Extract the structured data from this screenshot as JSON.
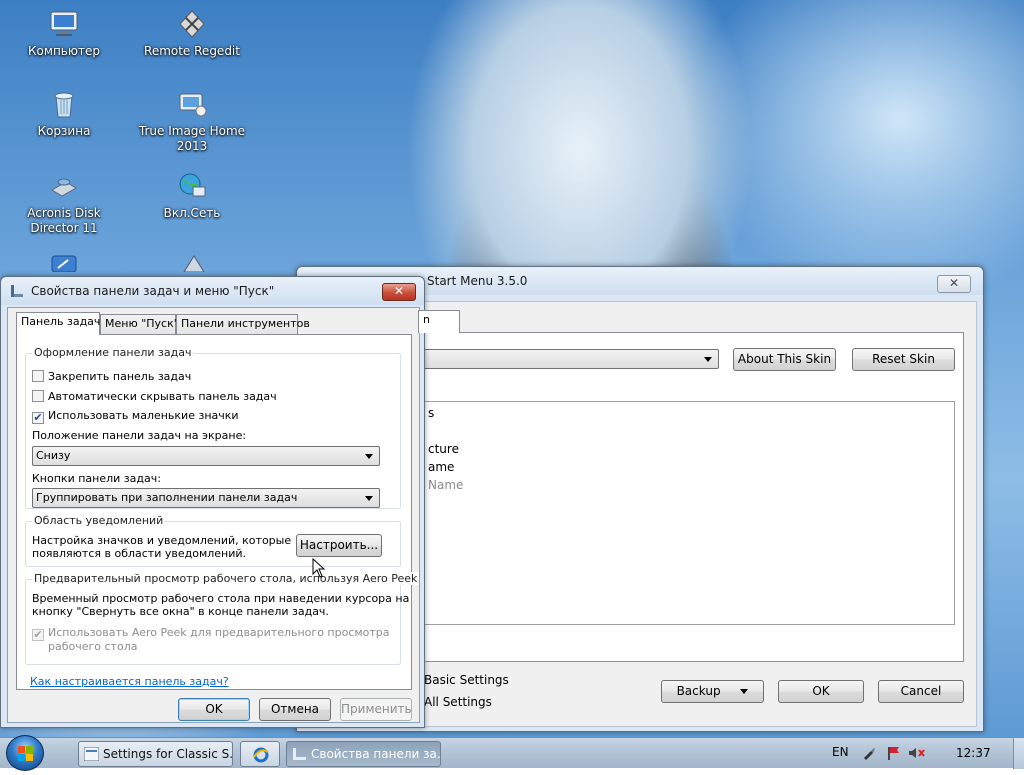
{
  "desktop": {
    "icons": [
      {
        "label": "Компьютер"
      },
      {
        "label": "Remote Regedit"
      },
      {
        "label": "Корзина"
      },
      {
        "label": "True Image Home 2013"
      },
      {
        "label": "Acronis Disk Director 11"
      },
      {
        "label": "Вкл.Сеть"
      }
    ]
  },
  "classic_window": {
    "title": "Start Menu 3.5.0",
    "tab_fragment": "n",
    "about_skin": "About This Skin",
    "reset_skin": "Reset Skin",
    "list_items": [
      "s",
      "cture",
      "ame",
      "Name"
    ],
    "radio_basic": "Basic Settings",
    "radio_all": "All Settings",
    "backup": "Backup",
    "ok": "OK",
    "cancel": "Cancel"
  },
  "taskbar_props": {
    "title": "Свойства панели задач и меню \"Пуск\"",
    "tabs": [
      "Панель задач",
      "Меню \"Пуск\"",
      "Панели инструментов"
    ],
    "group_appearance": "Оформление панели задач",
    "cb_lock": "Закрепить панель задач",
    "cb_autohide": "Автоматически скрывать панель задач",
    "cb_small_icons": "Использовать маленькие значки",
    "position_label": "Положение панели задач на экране:",
    "position_value": "Снизу",
    "buttons_label": "Кнопки панели задач:",
    "buttons_value": "Группировать при заполнении панели задач",
    "group_notify": "Область уведомлений",
    "notify_text_1": "Настройка значков и уведомлений, которые",
    "notify_text_2": "появляются в области уведомлений.",
    "configure_button": "Настроить...",
    "group_peek": "Предварительный просмотр рабочего стола, используя Aero Peek",
    "peek_text_1": "Временный просмотр рабочего стола при наведении курсора на",
    "peek_text_2": "кнопку \"Свернуть все окна\" в конце панели задач.",
    "cb_peek_1": "Использовать Aero Peek для предварительного просмотра",
    "cb_peek_2": "рабочего стола",
    "help_link": "Как настраивается панель задач?",
    "ok": "OK",
    "cancel": "Отмена",
    "apply": "Применить"
  },
  "taskbar": {
    "tasks": [
      "Settings for Classic S...",
      "Свойства панели за..."
    ],
    "lang": "EN",
    "clock": "12:37"
  }
}
